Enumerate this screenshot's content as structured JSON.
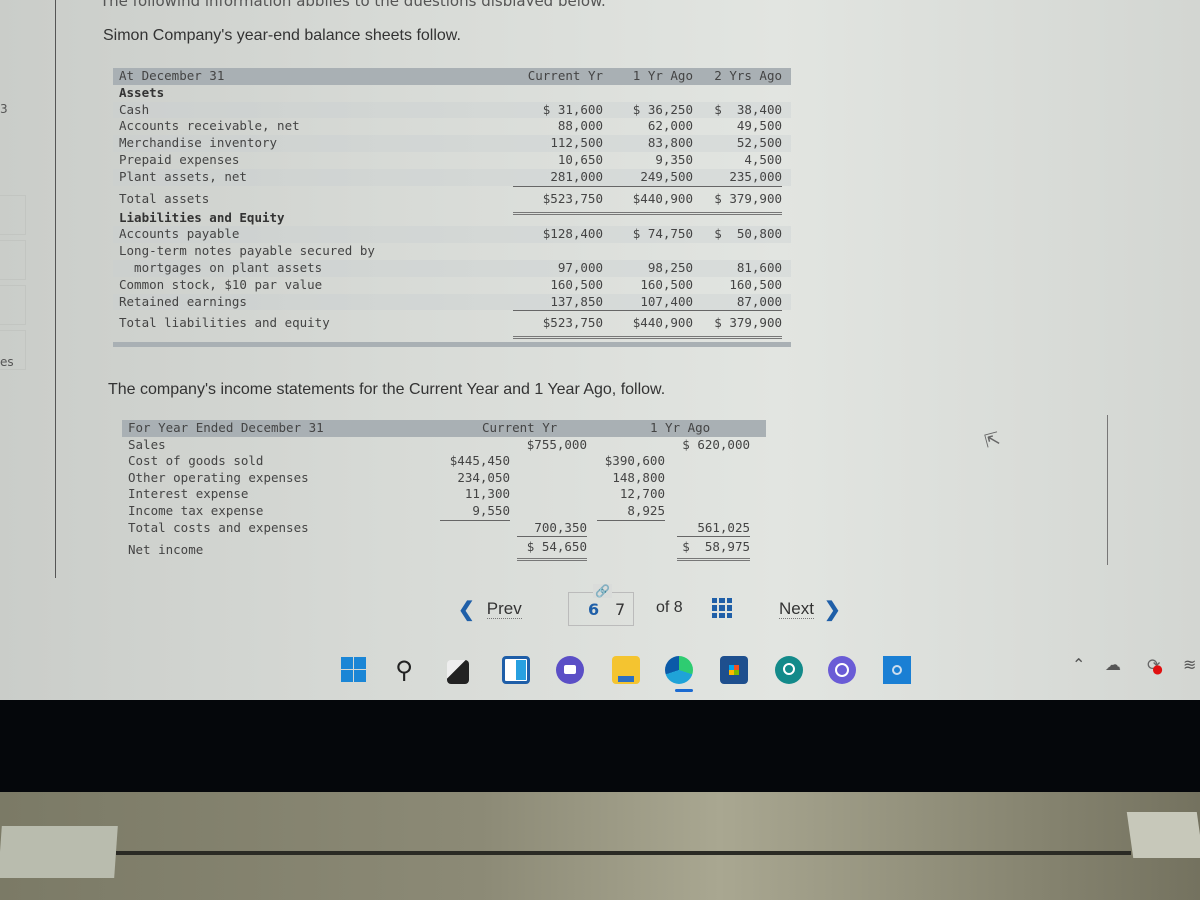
{
  "top_cut_text": "The following information applies to the questions displayed below.",
  "intro_balance": "Simon Company's year-end balance sheets follow.",
  "left_panel_fragments": [
    "3",
    "es"
  ],
  "balance_sheet": {
    "header": {
      "label": "At December 31",
      "cols": [
        "Current Yr",
        "1 Yr Ago",
        "2 Yrs Ago"
      ]
    },
    "assets_heading": "Assets",
    "assets": [
      {
        "label": "Cash",
        "values": [
          "$ 31,600",
          "$ 36,250",
          "$  38,400"
        ]
      },
      {
        "label": "Accounts receivable, net",
        "values": [
          "88,000",
          "62,000",
          "49,500"
        ]
      },
      {
        "label": "Merchandise inventory",
        "values": [
          "112,500",
          "83,800",
          "52,500"
        ]
      },
      {
        "label": "Prepaid expenses",
        "values": [
          "10,650",
          "9,350",
          "4,500"
        ]
      },
      {
        "label": "Plant assets, net",
        "values": [
          "281,000",
          "249,500",
          "235,000"
        ]
      }
    ],
    "total_assets": {
      "label": "Total assets",
      "values": [
        "$523,750",
        "$440,900",
        "$ 379,900"
      ]
    },
    "liab_heading": "Liabilities and Equity",
    "liabilities": [
      {
        "label": "Accounts payable",
        "values": [
          "$128,400",
          "$ 74,750",
          "$  50,800"
        ]
      },
      {
        "label": "Long-term notes payable secured by",
        "values": [
          "",
          "",
          ""
        ]
      },
      {
        "label": "  mortgages on plant assets",
        "values": [
          "97,000",
          "98,250",
          "81,600"
        ]
      },
      {
        "label": "Common stock, $10 par value",
        "values": [
          "160,500",
          "160,500",
          "160,500"
        ]
      },
      {
        "label": "Retained earnings",
        "values": [
          "137,850",
          "107,400",
          "87,000"
        ]
      }
    ],
    "total_liab": {
      "label": "Total liabilities and equity",
      "values": [
        "$523,750",
        "$440,900",
        "$ 379,900"
      ]
    }
  },
  "intro_income": "The company's income statements for the Current Year and 1 Year Ago, follow.",
  "income_statement": {
    "header": {
      "label": "For Year Ended December 31",
      "cols": [
        "Current Yr",
        "1 Yr Ago"
      ]
    },
    "sales": {
      "label": "Sales",
      "cur_total": "$755,000",
      "prev_total": "$ 620,000"
    },
    "expenses": [
      {
        "label": "Cost of goods sold",
        "cur": "$445,450",
        "prev": "$390,600"
      },
      {
        "label": "Other operating expenses",
        "cur": "234,050",
        "prev": "148,800"
      },
      {
        "label": "Interest expense",
        "cur": "11,300",
        "prev": "12,700"
      },
      {
        "label": "Income tax expense",
        "cur": "9,550",
        "prev": "8,925"
      }
    ],
    "total_costs": {
      "label": "Total costs and expenses",
      "cur_total": "700,350",
      "prev_total": "561,025"
    },
    "net_income": {
      "label": "Net income",
      "cur_total": "$ 54,650",
      "prev_total": "$  58,975"
    }
  },
  "pagination": {
    "prev_label": "Prev",
    "current_page": "6",
    "next_page": "7",
    "of_label": "of 8",
    "next_label": "Next"
  },
  "taskbar": {
    "apps": [
      "start",
      "search",
      "task-view",
      "widgets",
      "teams-chat",
      "file-explorer",
      "edge",
      "microsoft-store",
      "app-search",
      "app-sync",
      "cortana"
    ],
    "tray": [
      "show-hidden-icons",
      "onedrive",
      "sync-alert",
      "wifi"
    ]
  },
  "colors": {
    "accent": "#1f5fa8",
    "header_bar": "#a9b0b4"
  }
}
